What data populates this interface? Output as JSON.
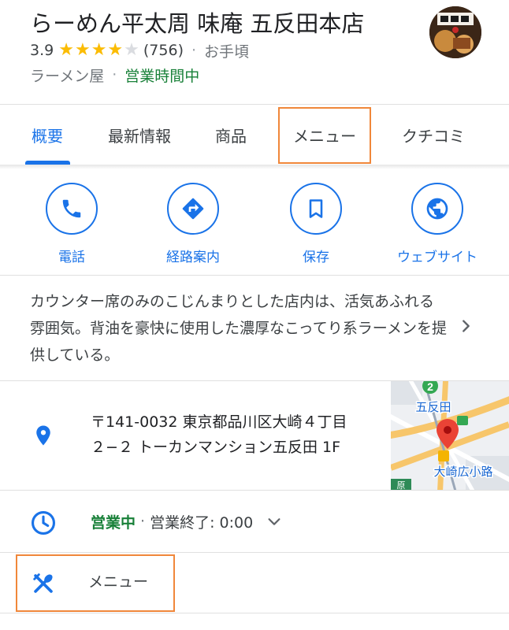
{
  "place": {
    "name": "らーめん平太周 味庵 五反田本店",
    "rating": "3.9",
    "stars_filled": 4,
    "stars_total": 5,
    "review_count": "(756)",
    "separator": "·",
    "price": "お手頃",
    "category": "ラーメン屋",
    "status_separator": "·",
    "status": "営業時間中",
    "thumbnail_icon": "restaurant-logo-photo"
  },
  "tabs": [
    {
      "label": "概要",
      "active": true
    },
    {
      "label": "最新情報",
      "active": false
    },
    {
      "label": "商品",
      "active": false
    },
    {
      "label": "メニュー",
      "active": false
    },
    {
      "label": "クチコミ",
      "active": false
    }
  ],
  "actions": [
    {
      "label": "電話",
      "icon": "phone-icon"
    },
    {
      "label": "経路案内",
      "icon": "directions-icon"
    },
    {
      "label": "保存",
      "icon": "bookmark-icon"
    },
    {
      "label": "ウェブサイト",
      "icon": "globe-icon"
    }
  ],
  "description": "カウンター席のみのこじんまりとした店内は、活気あふれる雰囲気。背油を豪快に使用した濃厚なこってり系ラーメンを提供している。",
  "address": {
    "line1": "〒141-0032 東京都品川区大崎４丁目",
    "line2": "２−２ トーカンマンション五反田 1F",
    "map": {
      "station1": "五反田",
      "station2": "大崎広小路",
      "route_badge": "2",
      "partial_label": "原"
    }
  },
  "hours": {
    "status": "営業中",
    "separator": "·",
    "closing": "営業終了: 0:00"
  },
  "menu_row": {
    "label": "メニュー"
  },
  "colors": {
    "accent": "#1a73e8",
    "open_green": "#188038",
    "star": "#fbbc04",
    "highlight_box": "#f0873a",
    "pin_red": "#ea4335"
  }
}
